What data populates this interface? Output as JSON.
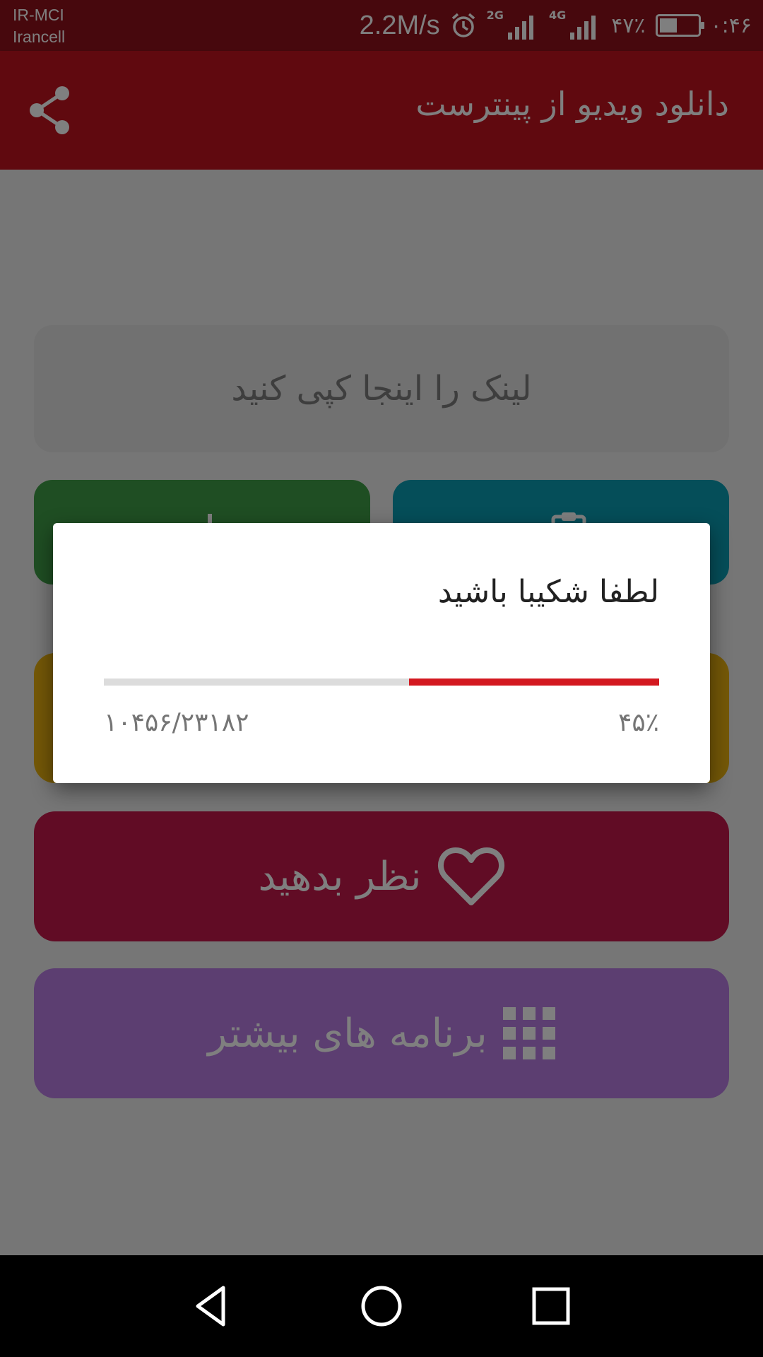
{
  "status_bar": {
    "carrier_1": "IR-MCI",
    "carrier_2": "Irancell",
    "net_speed": "2.2M/s",
    "network_1": "2G",
    "network_2": "4G",
    "battery_percent": "۴۷٪",
    "battery_level": 0.47,
    "time": "۰:۴۶",
    "icons": [
      "alarm-icon",
      "signal-icon",
      "signal-icon",
      "battery-icon"
    ]
  },
  "toolbar": {
    "title": "دانلود ویدیو از پینترست",
    "share_icon": "share-icon"
  },
  "main": {
    "link_input": {
      "value": "",
      "placeholder": "لینک را اینجا کپی کنید"
    },
    "paste_button": {
      "label": "",
      "icon": "clipboard-icon",
      "color": "#0a9cb3"
    },
    "download_button": {
      "label": "",
      "icon": "download-icon",
      "color": "#3f9d46"
    },
    "yellow_button": {
      "label": "",
      "color": "#e9b10e"
    },
    "rate_button": {
      "label": "نظر بدهید",
      "icon": "heart-icon",
      "color": "#c2184a"
    },
    "more_apps_button": {
      "label": "برنامه های بیشتر",
      "icon": "grid-icon",
      "color": "#b97ce2"
    }
  },
  "dialog": {
    "title": "لطفا شکیبا باشید",
    "progress_percent": "۴۵٪",
    "progress_fraction": 0.45,
    "progress_count": "۱۰۴۵۶/۲۳۱۸۲",
    "progress_color": "#d31920"
  },
  "nav_bar": {
    "icons": [
      "back-icon",
      "home-icon",
      "recents-icon"
    ]
  }
}
